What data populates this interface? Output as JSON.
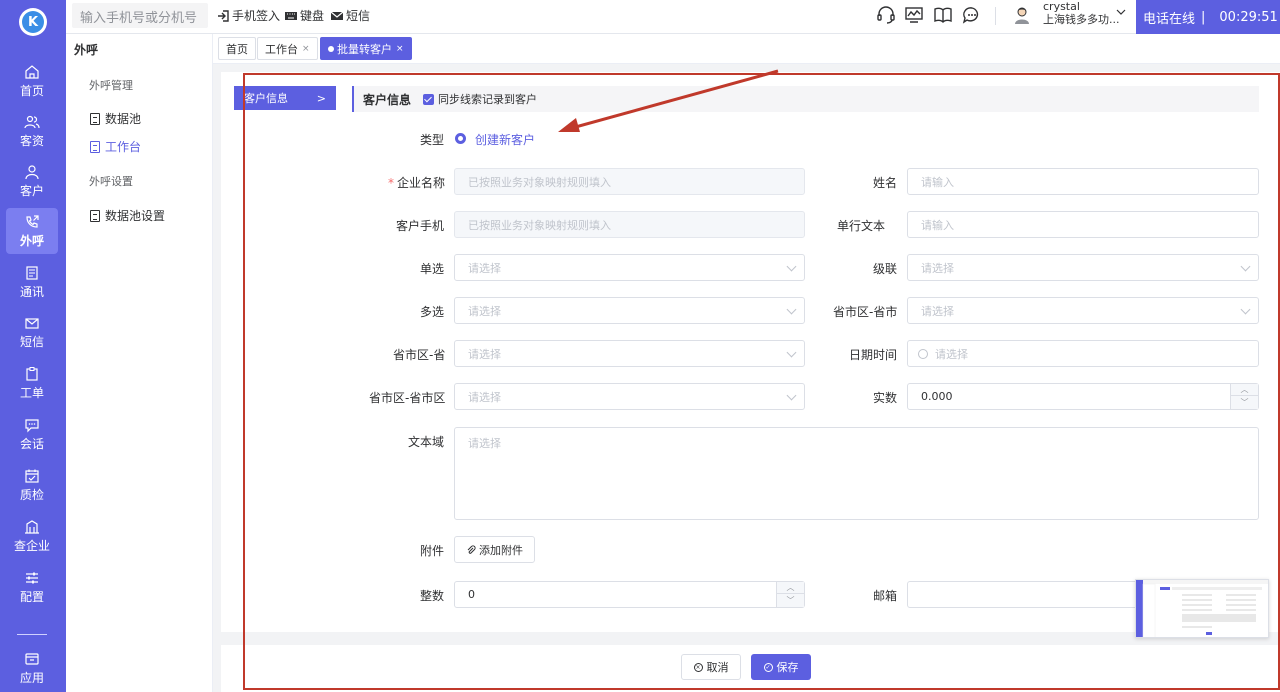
{
  "nav": {
    "logo_letter": "K",
    "items": [
      {
        "label": "首页",
        "icon": "home-icon"
      },
      {
        "label": "客资",
        "icon": "users-icon"
      },
      {
        "label": "客户",
        "icon": "user-icon"
      },
      {
        "label": "外呼",
        "icon": "phone-out-icon",
        "active": true
      },
      {
        "label": "通讯",
        "icon": "contacts-icon"
      },
      {
        "label": "短信",
        "icon": "sms-icon"
      },
      {
        "label": "工单",
        "icon": "clipboard-icon"
      },
      {
        "label": "会话",
        "icon": "chat-icon"
      },
      {
        "label": "质检",
        "icon": "inspect-icon"
      },
      {
        "label": "查企业",
        "icon": "building-icon"
      },
      {
        "label": "配置",
        "icon": "sliders-icon"
      },
      {
        "label": "应用",
        "icon": "apps-icon"
      }
    ]
  },
  "topbar": {
    "dial_placeholder": "输入手机号或分机号",
    "phone_signin": "手机签入",
    "keyboard": "键盘",
    "sms": "短信",
    "user_name": "crystal",
    "company": "上海钱多多功...",
    "status": "电话在线",
    "timer": "00:29:51"
  },
  "sidebar": {
    "title": "外呼",
    "section1": "外呼管理",
    "item1": "数据池",
    "item2": "工作台",
    "section2": "外呼设置",
    "item3": "数据池设置"
  },
  "tabs": {
    "home": "首页",
    "workbench": "工作台",
    "batch": "批量转客户",
    "close": "×"
  },
  "form": {
    "step_label": "客户信息",
    "section_title": "客户信息",
    "sync_label": "同步线索记录到客户",
    "type_label": "类型",
    "type_value": "创建新客户",
    "company_label": "企业名称",
    "company_placeholder": "已按照业务对象映射规则填入",
    "name_label": "姓名",
    "name_placeholder": "请输入",
    "phone_label": "客户手机",
    "phone_placeholder": "已按照业务对象映射规则填入",
    "singleline_label": "单行文本",
    "singleline_placeholder": "请输入",
    "single_label": "单选",
    "single_placeholder": "请选择",
    "cascade_label": "级联",
    "cascade_placeholder": "请选择",
    "multi_label": "多选",
    "multi_placeholder": "请选择",
    "prov_city_label": "省市区-省市",
    "prov_city_placeholder": "请选择",
    "prov_label": "省市区-省",
    "prov_placeholder": "请选择",
    "datetime_label": "日期时间",
    "datetime_placeholder": "请选择",
    "pcd_label": "省市区-省市区",
    "pcd_placeholder": "请选择",
    "real_label": "实数",
    "real_value": "0.000",
    "textarea_label": "文本域",
    "textarea_placeholder": "请选择",
    "attach_label": "附件",
    "attach_button": "添加附件",
    "int_label": "整数",
    "int_value": "0",
    "email_label": "邮箱"
  },
  "footer": {
    "cancel": "取消",
    "save": "保存"
  },
  "colors": {
    "accent": "#5c5fe0",
    "annotation": "#c0392b"
  }
}
